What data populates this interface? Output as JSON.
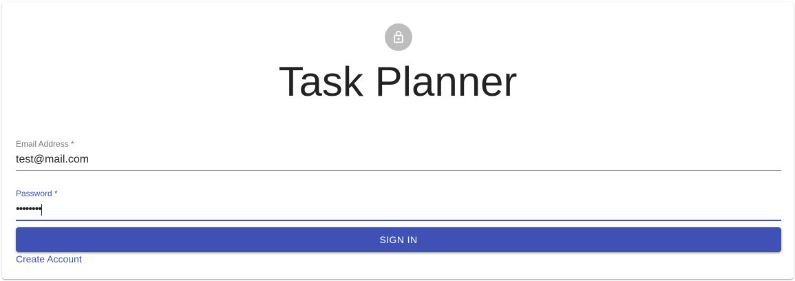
{
  "app": {
    "title": "Task Planner"
  },
  "icons": {
    "avatar": "lock-icon"
  },
  "colors": {
    "primary": "#3f51b5",
    "avatar_bg": "#bdbdbd",
    "text": "#222222"
  },
  "form": {
    "email": {
      "label": "Email Address *",
      "value": "test@mail.com"
    },
    "password": {
      "label": "Password *",
      "value": "••••••••"
    },
    "submit_label": "SIGN IN",
    "create_account_label": "Create Account"
  }
}
